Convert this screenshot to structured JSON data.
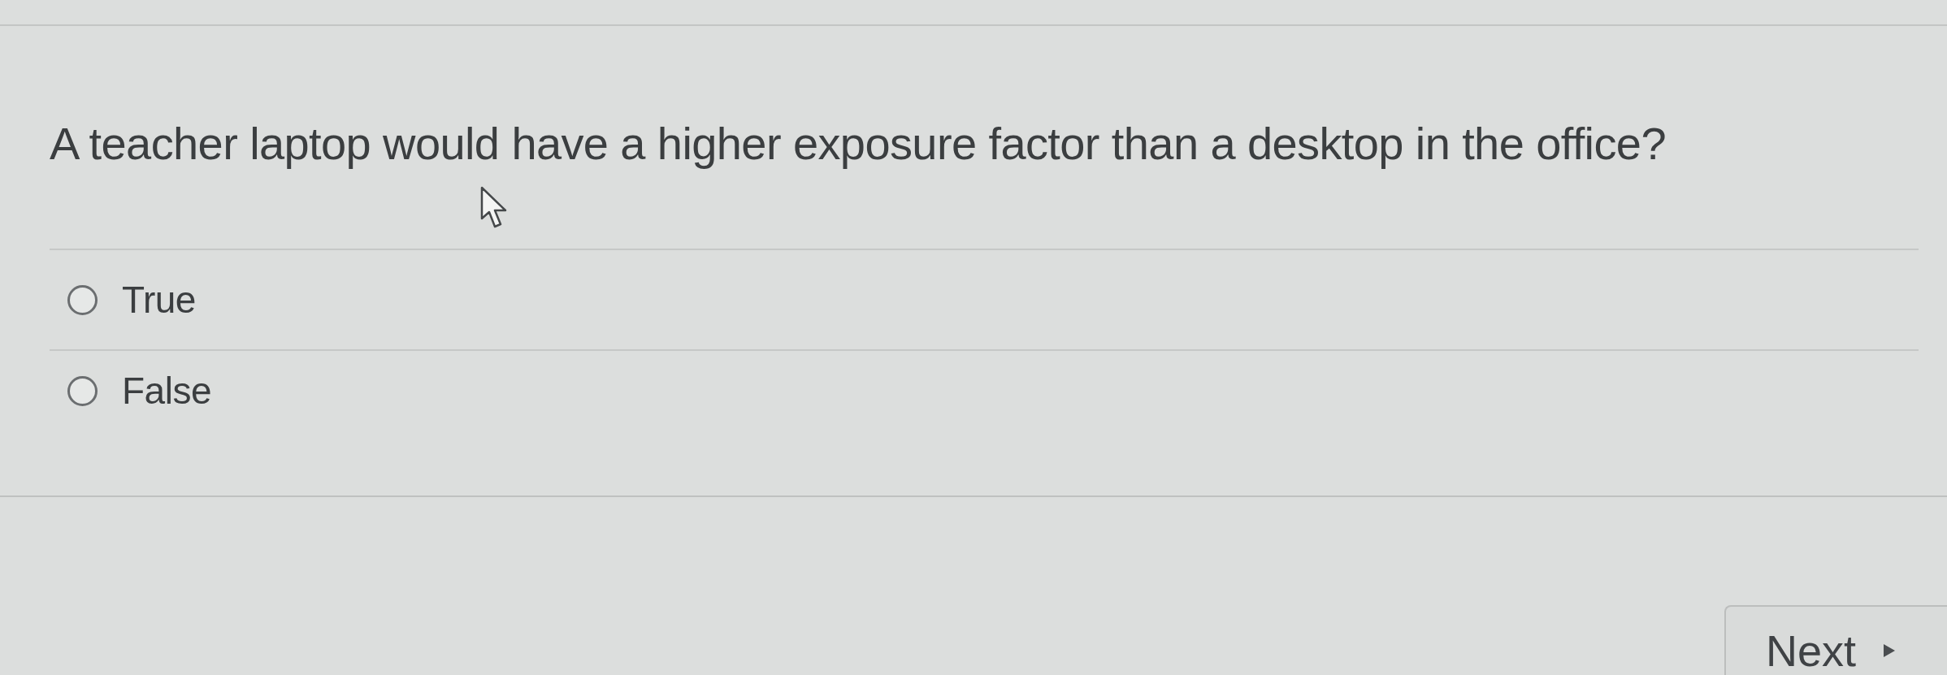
{
  "question": {
    "text": "A teacher laptop would have a higher exposure factor than a desktop in the office?"
  },
  "options": [
    {
      "label": "True",
      "selected": false
    },
    {
      "label": "False",
      "selected": false
    }
  ],
  "next_button": {
    "label": "Next"
  }
}
